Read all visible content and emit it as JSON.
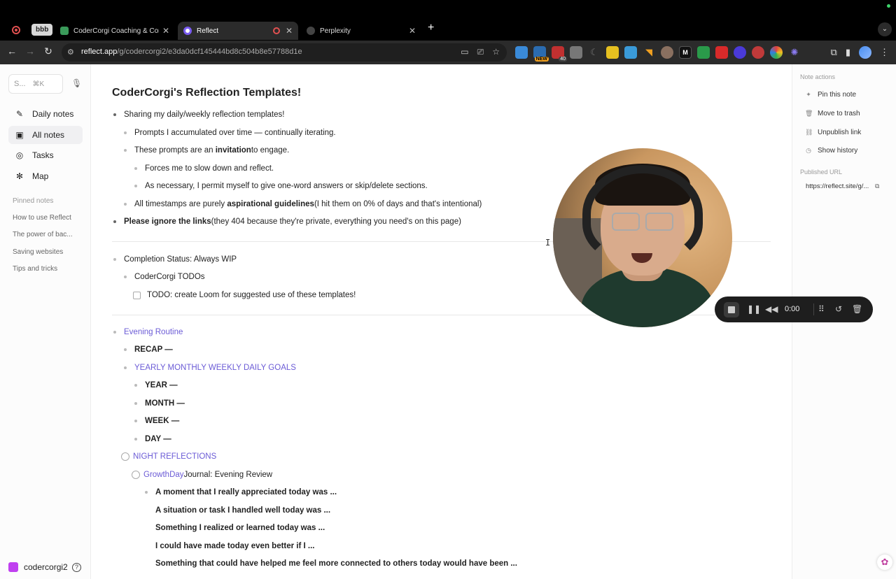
{
  "browser": {
    "group_label": "bbb",
    "tabs": [
      {
        "title": "CoderCorgi Coaching & Cons",
        "color": "#3a9a5a"
      },
      {
        "title": "Reflect",
        "color": "#7a5cf0"
      },
      {
        "title": "Perplexity",
        "color": "#888888"
      }
    ],
    "url_host": "reflect.app",
    "url_path": "/g/codercorgi2/e3da0dcf145444bd8c504b8e57788d1e",
    "ext_badges": {
      "new": "NEW",
      "count": "40"
    }
  },
  "sidebar": {
    "search_placeholder": "S...",
    "search_shortcut": "⌘K",
    "nav": [
      {
        "label": "Daily notes",
        "icon": "✎"
      },
      {
        "label": "All notes",
        "icon": "▣"
      },
      {
        "label": "Tasks",
        "icon": "◎"
      },
      {
        "label": "Map",
        "icon": "✻"
      }
    ],
    "pinned_heading": "Pinned notes",
    "pinned": [
      "How to use Reflect",
      "The power of bac...",
      "Saving websites",
      "Tips and tricks"
    ],
    "username": "codercorgi2"
  },
  "note": {
    "title": "CoderCorgi's Reflection Templates!",
    "l1": "Sharing my daily/weekly reflection templates!",
    "l2": "Prompts I accumulated over time — continually iterating.",
    "l3a": "These prompts are an ",
    "l3b": "invitation",
    "l3c": " to engage.",
    "l4": "Forces me to slow down and reflect.",
    "l5": "As necessary, I permit myself to give one-word answers or skip/delete sections.",
    "l6a": "All timestamps are purely ",
    "l6b": "aspirational guidelines",
    "l6c": " (I hit them on 0% of days and that's intentional)",
    "l7a": "Please ignore the links",
    "l7b": " (they 404 because they're private, everything you need's on this page)",
    "l8": "Completion Status: Always WIP",
    "l9": "CoderCorgi TODOs",
    "l10": "TODO: create Loom for suggested use of these templates!",
    "l11": "Evening Routine",
    "l12": "RECAP —",
    "l13": "YEARLY MONTHLY WEEKLY DAILY GOALS",
    "l14": "YEAR —",
    "l15": "MONTH —",
    "l16": "WEEK —",
    "l17": "DAY —",
    "l18": "NIGHT REFLECTIONS",
    "l19a": "GrowthDay",
    "l19b": " Journal: Evening Review",
    "q1": "A moment that I really appreciated today was ...",
    "q2": "A situation or task I handled well today was ...",
    "q3": "Something I realized or learned today was ...",
    "q4": "I could have made today even better if I ...",
    "q5": "Something that could have helped me feel more connected to others today would have been ..."
  },
  "right_panel": {
    "heading": "Note actions",
    "actions": [
      {
        "label": "Pin this note",
        "icon": "✦"
      },
      {
        "label": "Move to trash",
        "icon": "🗑"
      },
      {
        "label": "Unpublish link",
        "icon": "⛓"
      },
      {
        "label": "Show history",
        "icon": "◷"
      }
    ],
    "published_heading": "Published URL",
    "published_url": "https://reflect.site/g/..."
  },
  "recorder": {
    "time": "0:00"
  },
  "colors": {
    "accent": "#6b5bd6",
    "user_square": "#c040f0",
    "recording_red": "#e05050"
  }
}
